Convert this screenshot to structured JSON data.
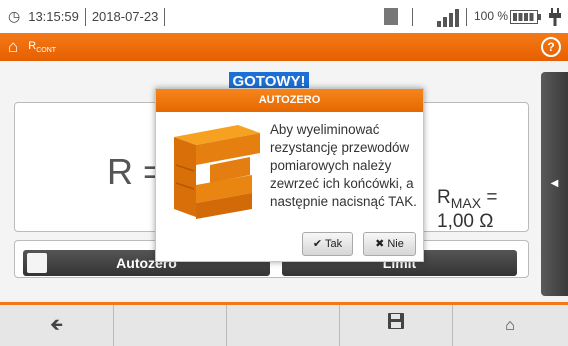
{
  "status": {
    "time": "13:15:59",
    "date": "2018-07-23",
    "battery_pct": "100 %"
  },
  "header": {
    "title_main": "R",
    "title_sub": "CONT"
  },
  "main": {
    "status_badge": "GOTOWY!",
    "measurement": {
      "label": "R =",
      "max_label": "R",
      "max_sub": "MAX",
      "max_value": "= 1,00 Ω"
    },
    "buttons": {
      "autozero": "Autozero",
      "limit": "Limit"
    }
  },
  "modal": {
    "title": "AUTOZERO",
    "text": "Aby wyeliminować rezystancję przewodów pomiarowych należy zewrzeć ich końcówki, a następnie nacisnąć TAK.",
    "yes_label": "Tak",
    "no_label": "Nie"
  },
  "colors": {
    "accent": "#ef6f0d",
    "badge": "#1c6fd4",
    "button_dark": "#3d3d3d"
  },
  "icons": [
    "clock-icon",
    "no-sim-icon",
    "signal-icon",
    "battery-icon",
    "plug-icon",
    "home-icon",
    "help-icon",
    "back-arrow-icon",
    "save-icon",
    "checkmark-icon",
    "x-icon",
    "panel-arrow-left-icon"
  ]
}
